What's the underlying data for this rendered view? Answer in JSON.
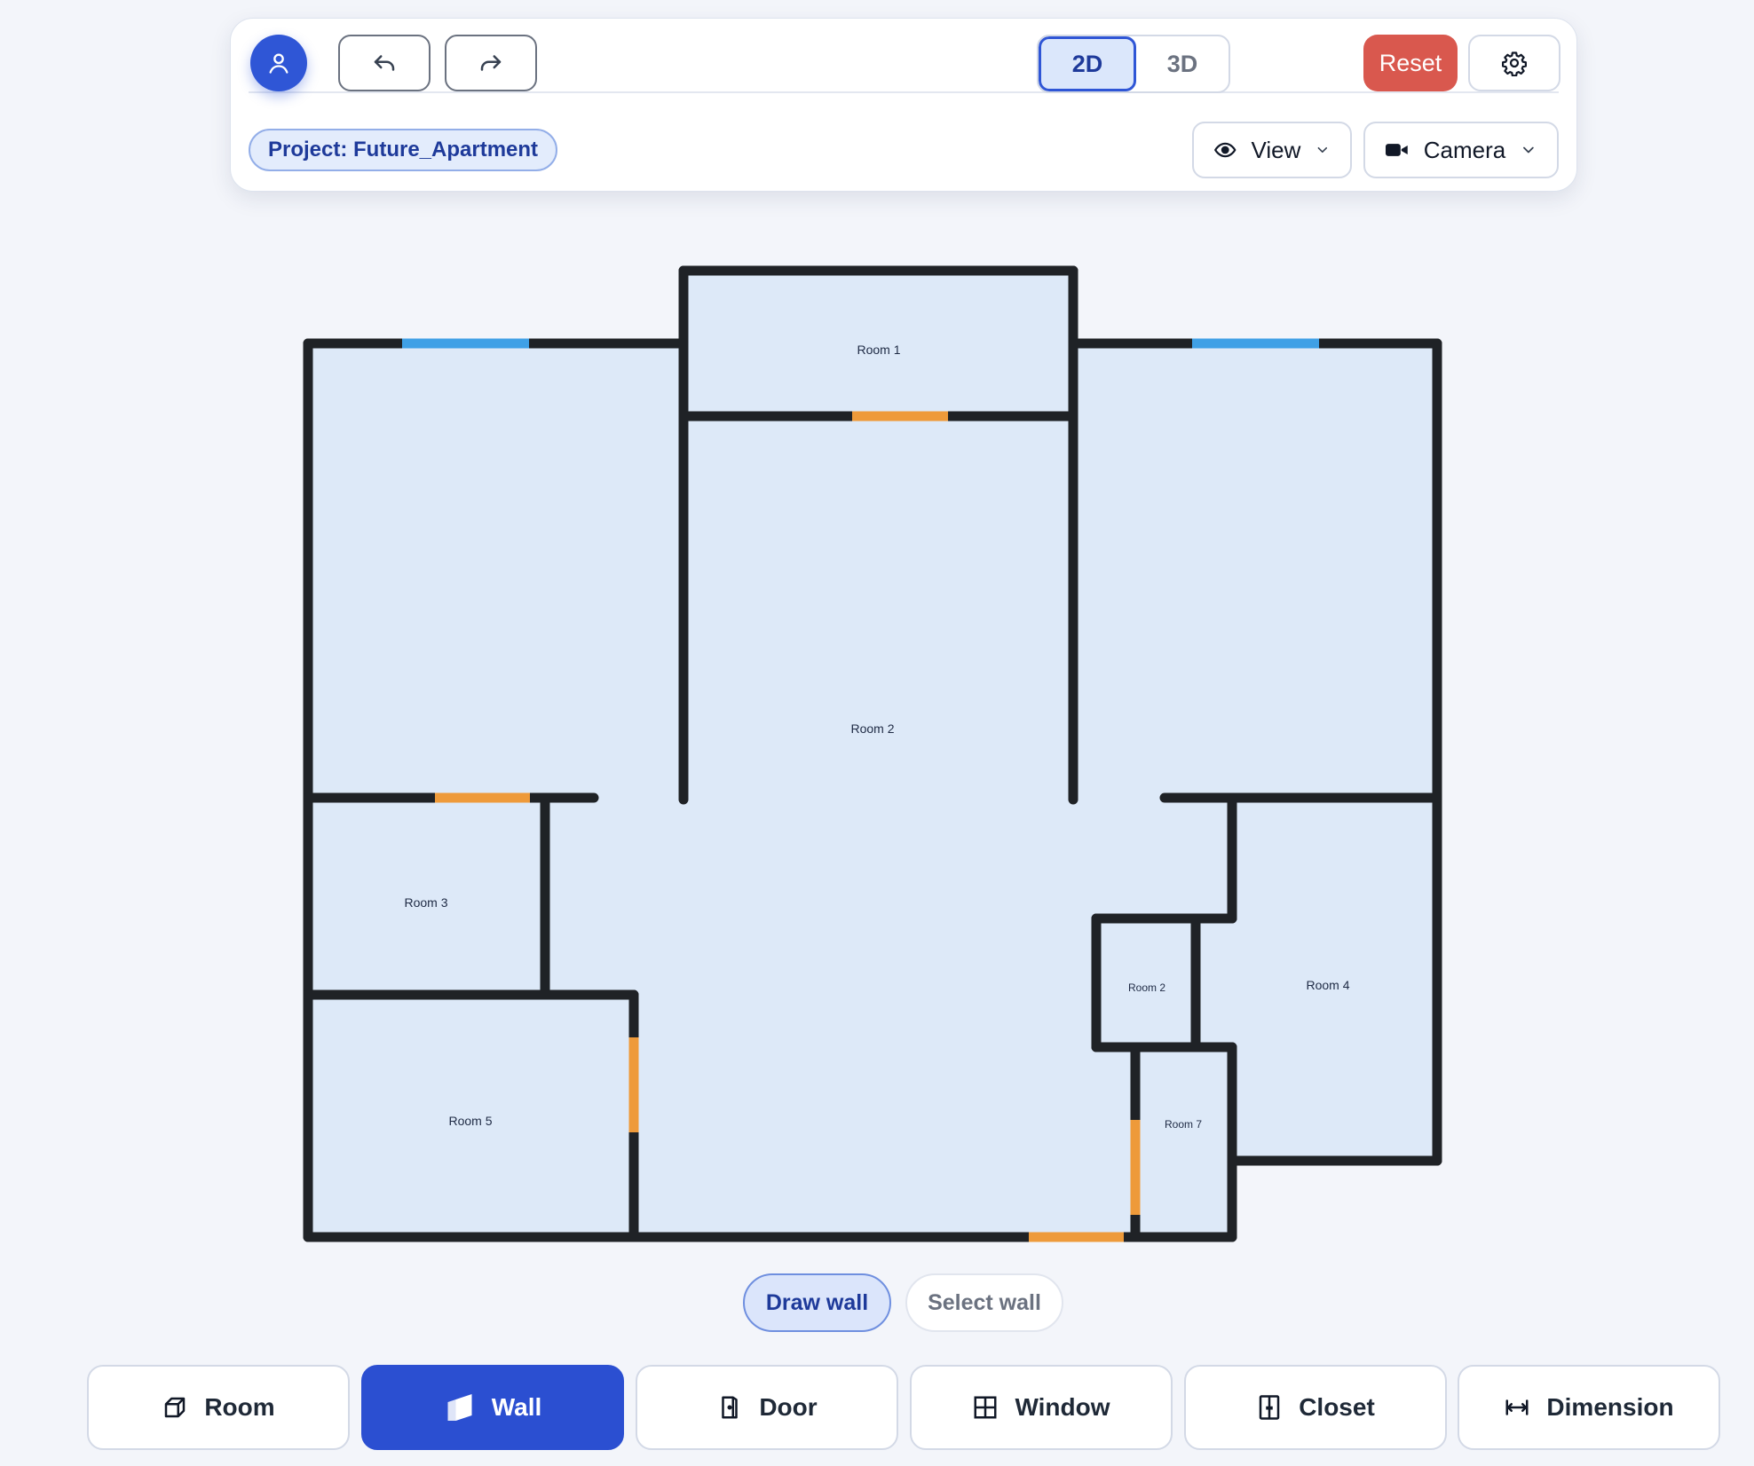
{
  "toolbar": {
    "view_modes": [
      "2D",
      "3D"
    ],
    "active_view_mode": "2D",
    "reset_label": "Reset",
    "project_label": "Project: Future_Apartment",
    "view_dropdown_label": "View",
    "camera_dropdown_label": "Camera"
  },
  "plan": {
    "rooms": [
      {
        "label": "Room 1"
      },
      {
        "label": "Room 2"
      },
      {
        "label": "Room 3"
      },
      {
        "label": "Room 5"
      },
      {
        "label": "Room 2"
      },
      {
        "label": "Room 4"
      },
      {
        "label": "Room 7"
      }
    ],
    "colors": {
      "floor": "#dde9f8",
      "wall": "#1f2226",
      "window": "#3fa0e6",
      "door": "#ee9a3a"
    }
  },
  "modes": {
    "draw_label": "Draw wall",
    "select_label": "Select wall",
    "active": "Draw wall"
  },
  "tools": [
    {
      "label": "Room",
      "icon": "room-icon"
    },
    {
      "label": "Wall",
      "icon": "wall-icon",
      "active": true
    },
    {
      "label": "Door",
      "icon": "door-icon"
    },
    {
      "label": "Window",
      "icon": "window-icon"
    },
    {
      "label": "Closet",
      "icon": "closet-icon"
    },
    {
      "label": "Dimension",
      "icon": "dimension-icon"
    }
  ],
  "accent_color": "#2b4fd1",
  "reset_color": "#d9584e"
}
